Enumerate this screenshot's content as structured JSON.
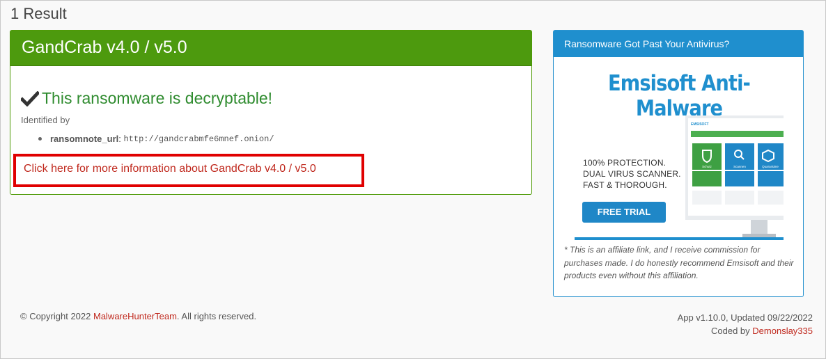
{
  "results": {
    "heading": "1 Result"
  },
  "result_card": {
    "title": "GandCrab v4.0 / v5.0",
    "status_text": "This ransomware is decryptable!",
    "status_icon": "checkmark-icon",
    "identified_label": "Identified by",
    "identifiers": [
      {
        "key": "ransomnote_url",
        "separator": ":",
        "value": "http://gandcrabmfe6mnef.onion/"
      }
    ],
    "more_info_link": "Click here for more information about GandCrab v4.0 / v5.0",
    "highlight_color": "#e00000"
  },
  "ad": {
    "header": "Ransomware Got Past Your Antivirus?",
    "brand": "Emsisoft Anti-Malware",
    "tagline": [
      "100% PROTECTION.",
      "DUAL VIRUS SCANNER.",
      "FAST & THOROUGH."
    ],
    "button_label": "FREE TRIAL",
    "monitor_tiles": [
      "Schutz",
      "Scannen",
      "Quarantäne"
    ],
    "monitor_logo": "EMSISOFT",
    "disclaimer": "* This is an affiliate link, and I receive commission for purchases made. I do honestly recommend Emsisoft and their products even without this affiliation.",
    "accent_color": "#1f8fce"
  },
  "footer": {
    "copyright_prefix": "© Copyright 2022 ",
    "copyright_link": "MalwareHunterTeam",
    "copyright_suffix": ". All rights reserved.",
    "version": "App v1.10.0, Updated 09/22/2022",
    "coded_by_prefix": "Coded by ",
    "coded_by_link": "Demonslay335"
  },
  "colors": {
    "success_green": "#4d9a0e",
    "link_red": "#c0291e",
    "ad_blue": "#1f8fce"
  }
}
